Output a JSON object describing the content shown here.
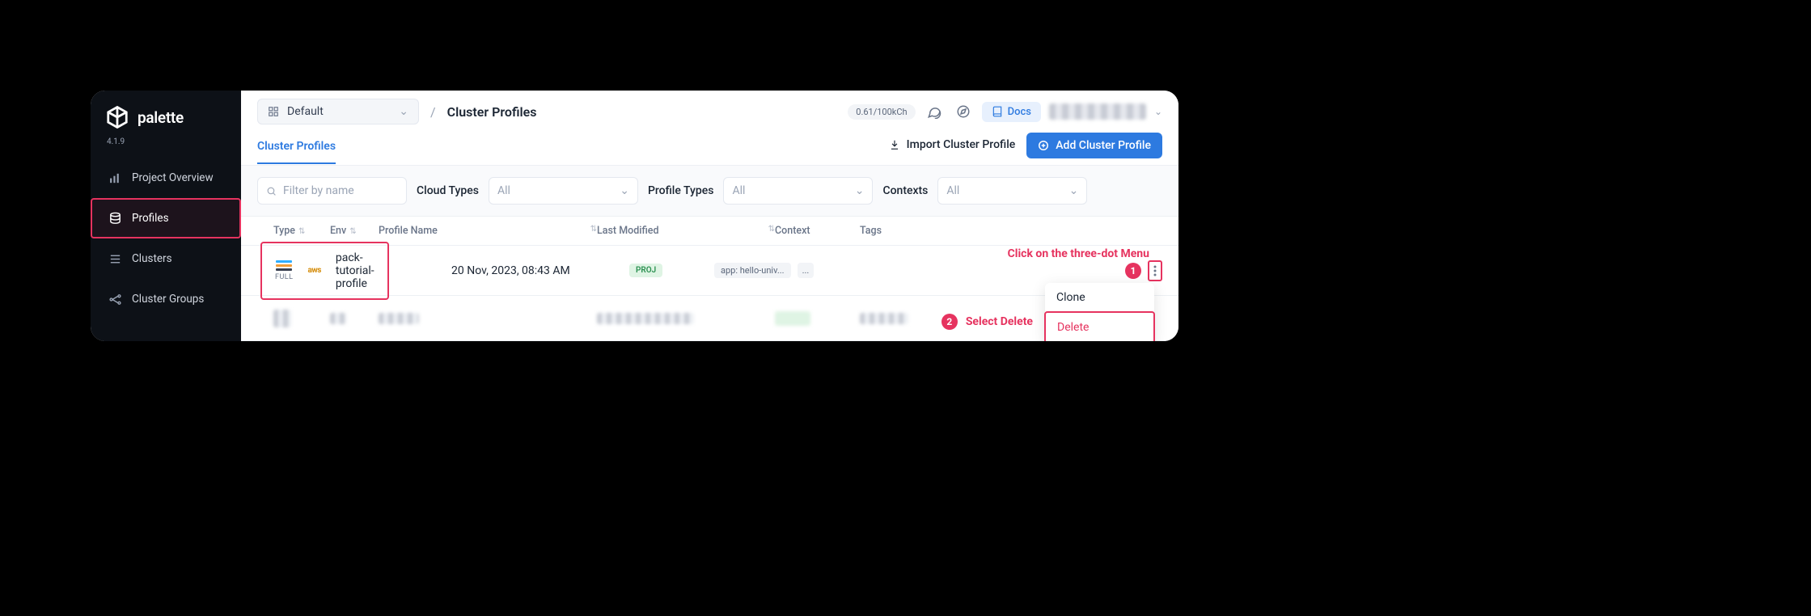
{
  "brand": {
    "name": "palette",
    "version": "4.1.9"
  },
  "sidebar": {
    "items": [
      {
        "label": "Project Overview"
      },
      {
        "label": "Profiles"
      },
      {
        "label": "Clusters"
      },
      {
        "label": "Cluster Groups"
      }
    ]
  },
  "topbar": {
    "scope": "Default",
    "breadcrumb_sep": "/",
    "breadcrumb_current": "Cluster Profiles",
    "usage_pill": "0.61/100kCh",
    "docs_label": "Docs"
  },
  "tabs": {
    "active": "Cluster Profiles",
    "import_label": "Import Cluster Profile",
    "add_label": "Add Cluster Profile"
  },
  "filters": {
    "search_placeholder": "Filter by name",
    "cloud_label": "Cloud Types",
    "cloud_value": "All",
    "profile_label": "Profile Types",
    "profile_value": "All",
    "context_label": "Contexts",
    "context_value": "All"
  },
  "columns": {
    "type": "Type",
    "env": "Env",
    "name": "Profile Name",
    "modified": "Last Modified",
    "context": "Context",
    "tags": "Tags"
  },
  "rows": [
    {
      "type_label": "FULL",
      "env": "aws",
      "name": "pack-tutorial-profile",
      "modified": "20 Nov, 2023, 08:43 AM",
      "context": "PROJ",
      "tag": "app: hello-univ...",
      "tag_more": "..."
    }
  ],
  "context_menu": {
    "clone": "Clone",
    "delete": "Delete"
  },
  "annotations": {
    "step1_num": "1",
    "step1_text": "Click on the three-dot Menu",
    "step2_num": "2",
    "step2_text": "Select Delete"
  }
}
